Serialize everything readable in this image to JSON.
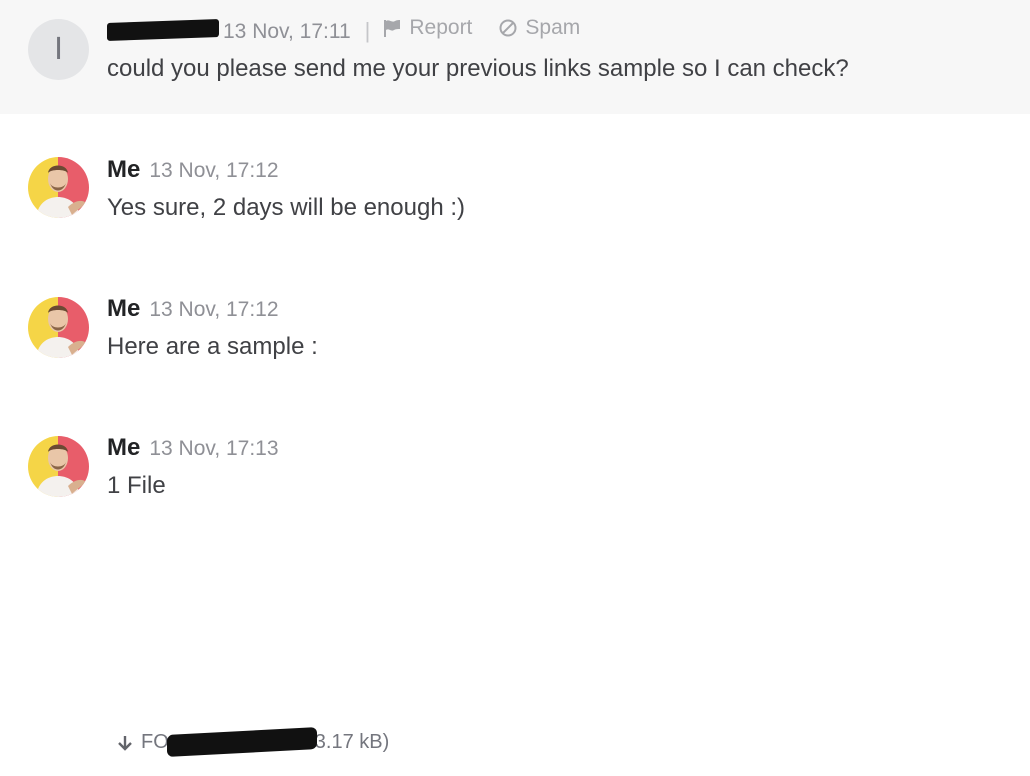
{
  "messages": [
    {
      "avatar_letter": "I",
      "sender_redacted": true,
      "time": "13 Nov, 17:11",
      "actions": {
        "report": "Report",
        "spam": "Spam"
      },
      "text": "could you please send me your previous links sample so I can check?"
    },
    {
      "sender": "Me",
      "time": "13 Nov, 17:12",
      "text": "Yes sure, 2 days will be enough :)"
    },
    {
      "sender": "Me",
      "time": "13 Nov, 17:12",
      "text": "Here are a sample :"
    },
    {
      "sender": "Me",
      "time": "13 Nov, 17:13",
      "text": "1 File"
    }
  ],
  "attachment": {
    "name_start": "FO",
    "name_redacted": true,
    "size": "3.17 kB)"
  },
  "icons": {
    "report": "flag-icon",
    "spam": "block-icon",
    "download": "download-arrow-icon"
  },
  "colors": {
    "highlight_bg": "#f7f7f7",
    "avatar_yellow": "#f5d547",
    "avatar_red": "#e85d6a"
  }
}
